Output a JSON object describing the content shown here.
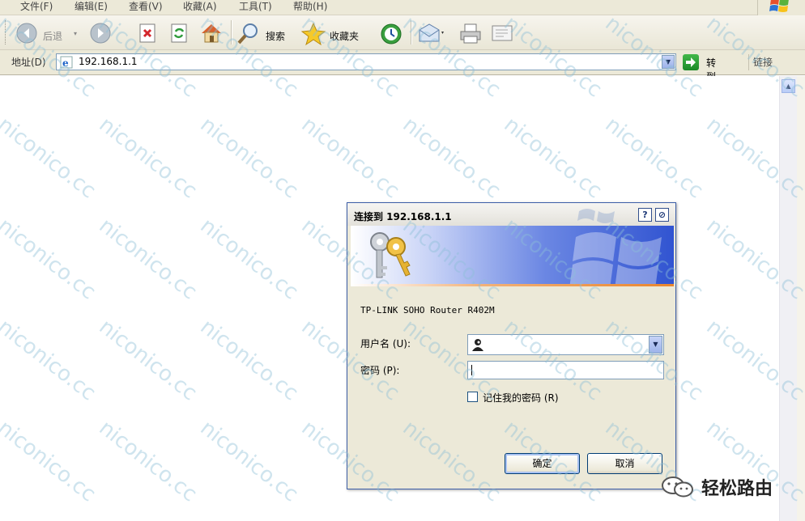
{
  "menu": [
    "文件(F)",
    "编辑(E)",
    "查看(V)",
    "收藏(A)",
    "工具(T)",
    "帮助(H)"
  ],
  "toolbar": {
    "back": "后退",
    "search": "搜索",
    "favorites": "收藏夹"
  },
  "address": {
    "label": "地址(D)",
    "url": "192.168.1.1",
    "go": "转到",
    "links": "链接"
  },
  "dialog": {
    "title": "连接到 192.168.1.1",
    "realm": "TP-LINK SOHO Router R402M",
    "username_label": "用户名 (U):",
    "password_label": "密码 (P):",
    "username_value": "",
    "password_value": "",
    "remember_label": "记住我的密码 (R)",
    "remember_checked": false,
    "ok": "确定",
    "cancel": "取消",
    "help_btn": "?",
    "close_btn": "⊘"
  },
  "watermark": "niconico.cc",
  "brand": "轻松路由",
  "colors": {
    "dialog_border": "#3d5fa8",
    "banner_blue": "#3154d1",
    "chrome": "#ece9d8",
    "watermark": "#8cbed7"
  }
}
